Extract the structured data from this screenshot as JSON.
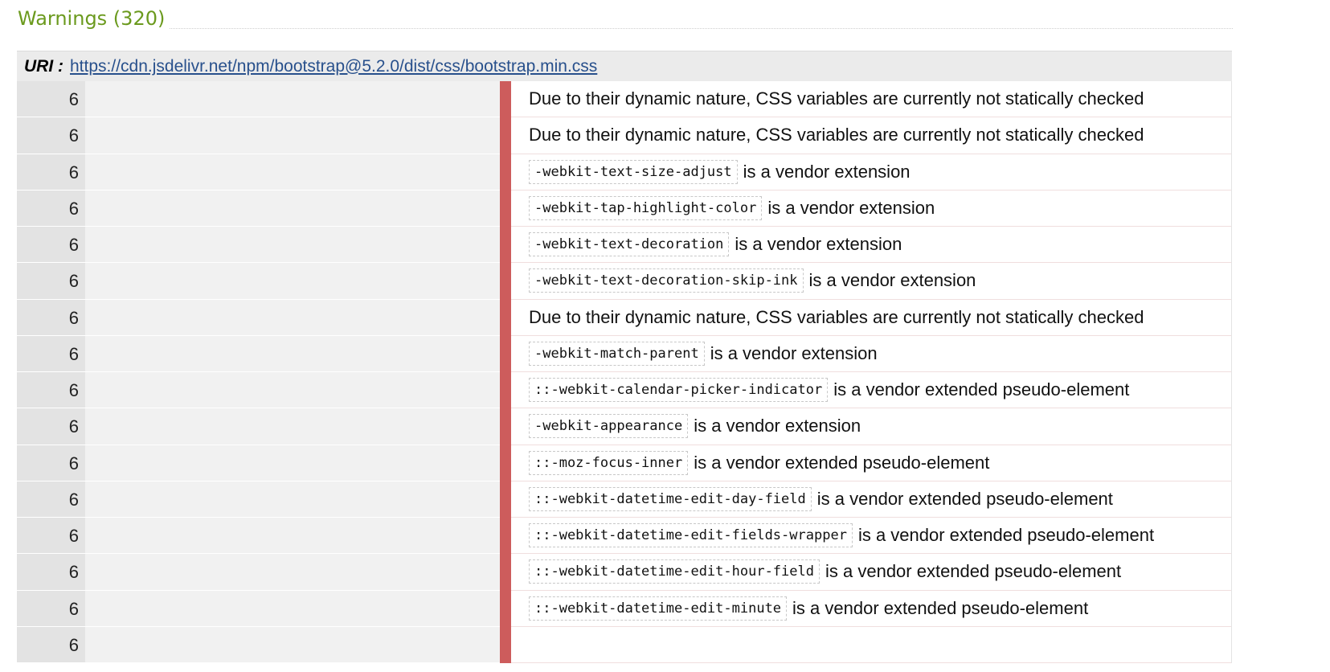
{
  "heading": "Warnings (320)",
  "uri": {
    "label": "URI :",
    "link": "https://cdn.jsdelivr.net/npm/bootstrap@5.2.0/dist/css/bootstrap.min.css"
  },
  "colors": {
    "heading": "#6b9a1e",
    "marker": "#cd5c5c",
    "link": "#28508c"
  },
  "rows": [
    {
      "line": "6",
      "code": "",
      "message": "Due to their dynamic nature, CSS variables are currently not statically checked"
    },
    {
      "line": "6",
      "code": "",
      "message": "Due to their dynamic nature, CSS variables are currently not statically checked"
    },
    {
      "line": "6",
      "code": "-webkit-text-size-adjust",
      "message": "is a vendor extension"
    },
    {
      "line": "6",
      "code": "-webkit-tap-highlight-color",
      "message": "is a vendor extension"
    },
    {
      "line": "6",
      "code": "-webkit-text-decoration",
      "message": "is a vendor extension"
    },
    {
      "line": "6",
      "code": "-webkit-text-decoration-skip-ink",
      "message": "is a vendor extension"
    },
    {
      "line": "6",
      "code": "",
      "message": "Due to their dynamic nature, CSS variables are currently not statically checked"
    },
    {
      "line": "6",
      "code": "-webkit-match-parent",
      "message": "is a vendor extension"
    },
    {
      "line": "6",
      "code": "::-webkit-calendar-picker-indicator",
      "message": "is a vendor extended pseudo-element"
    },
    {
      "line": "6",
      "code": "-webkit-appearance",
      "message": "is a vendor extension"
    },
    {
      "line": "6",
      "code": "::-moz-focus-inner",
      "message": "is a vendor extended pseudo-element"
    },
    {
      "line": "6",
      "code": "::-webkit-datetime-edit-day-field",
      "message": "is a vendor extended pseudo-element"
    },
    {
      "line": "6",
      "code": "::-webkit-datetime-edit-fields-wrapper",
      "message": "is a vendor extended pseudo-element"
    },
    {
      "line": "6",
      "code": "::-webkit-datetime-edit-hour-field",
      "message": "is a vendor extended pseudo-element"
    },
    {
      "line": "6",
      "code": "::-webkit-datetime-edit-minute",
      "message": "is a vendor extended pseudo-element"
    },
    {
      "line": "6",
      "code": "",
      "message": ""
    }
  ]
}
